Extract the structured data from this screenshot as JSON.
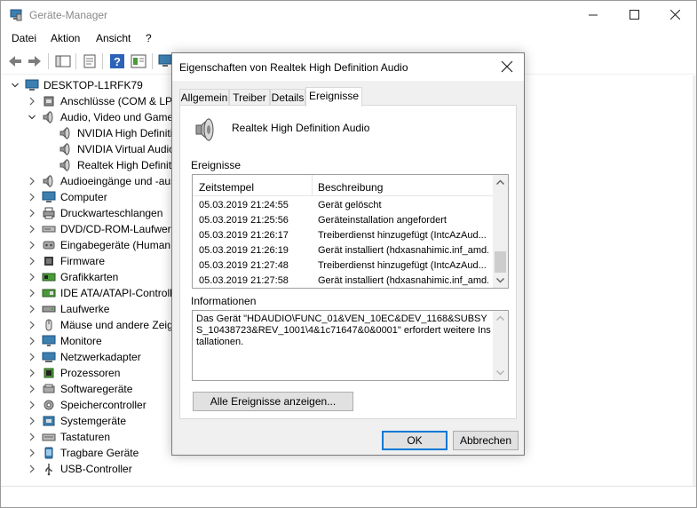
{
  "window": {
    "title": "Geräte-Manager",
    "menu": [
      "Datei",
      "Aktion",
      "Ansicht",
      "?"
    ]
  },
  "toolbar": {
    "icons": [
      "back-arrow-icon",
      "forward-arrow-icon",
      "show-hide-console-tree-icon",
      "properties-icon",
      "help-icon",
      "details-pane-icon",
      "monitor-scan-icon"
    ]
  },
  "tree": {
    "root": "DESKTOP-L1RFK79",
    "items": [
      {
        "label": "Anschlüsse (COM & LPT)",
        "icon": "port-icon",
        "expanded": false,
        "level": 1
      },
      {
        "label": "Audio, Video und Gamecontroller",
        "icon": "speaker-icon",
        "expanded": true,
        "level": 1
      },
      {
        "label": "NVIDIA High Definition Audio",
        "icon": "speaker-icon",
        "level": 2
      },
      {
        "label": "NVIDIA Virtual Audio Device",
        "icon": "speaker-icon",
        "level": 2
      },
      {
        "label": "Realtek High Definition Audio",
        "icon": "speaker-icon",
        "level": 2
      },
      {
        "label": "Audioeingänge und -ausgänge",
        "icon": "speaker-icon",
        "expanded": false,
        "level": 1
      },
      {
        "label": "Computer",
        "icon": "computer-icon",
        "expanded": false,
        "level": 1
      },
      {
        "label": "Druckwarteschlangen",
        "icon": "printer-icon",
        "expanded": false,
        "level": 1
      },
      {
        "label": "DVD/CD-ROM-Laufwerke",
        "icon": "disc-drive-icon",
        "expanded": false,
        "level": 1
      },
      {
        "label": "Eingabegeräte (Human Interface Devices)",
        "icon": "hid-icon",
        "expanded": false,
        "level": 1
      },
      {
        "label": "Firmware",
        "icon": "firmware-icon",
        "expanded": false,
        "level": 1
      },
      {
        "label": "Grafikkarten",
        "icon": "display-adapter-icon",
        "expanded": false,
        "level": 1
      },
      {
        "label": "IDE ATA/ATAPI-Controller",
        "icon": "ide-controller-icon",
        "expanded": false,
        "level": 1
      },
      {
        "label": "Laufwerke",
        "icon": "disk-drive-icon",
        "expanded": false,
        "level": 1
      },
      {
        "label": "Mäuse und andere Zeigegeräte",
        "icon": "mouse-icon",
        "expanded": false,
        "level": 1
      },
      {
        "label": "Monitore",
        "icon": "monitor-icon",
        "expanded": false,
        "level": 1
      },
      {
        "label": "Netzwerkadapter",
        "icon": "network-adapter-icon",
        "expanded": false,
        "level": 1
      },
      {
        "label": "Prozessoren",
        "icon": "processor-icon",
        "expanded": false,
        "level": 1
      },
      {
        "label": "Softwaregeräte",
        "icon": "software-device-icon",
        "expanded": false,
        "level": 1
      },
      {
        "label": "Speichercontroller",
        "icon": "storage-controller-icon",
        "expanded": false,
        "level": 1
      },
      {
        "label": "Systemgeräte",
        "icon": "system-device-icon",
        "expanded": false,
        "level": 1
      },
      {
        "label": "Tastaturen",
        "icon": "keyboard-icon",
        "expanded": false,
        "level": 1
      },
      {
        "label": "Tragbare Geräte",
        "icon": "portable-device-icon",
        "expanded": false,
        "level": 1
      },
      {
        "label": "USB-Controller",
        "icon": "usb-icon",
        "expanded": false,
        "level": 1
      }
    ]
  },
  "dialog": {
    "title": "Eigenschaften von Realtek High Definition Audio",
    "tabs": [
      "Allgemein",
      "Treiber",
      "Details",
      "Ereignisse"
    ],
    "active_tab": "Ereignisse",
    "device_name": "Realtek High Definition Audio",
    "events_label": "Ereignisse",
    "columns": [
      "Zeitstempel",
      "Beschreibung"
    ],
    "events": [
      {
        "time": "05.03.2019 21:24:55",
        "desc": "Gerät gelöscht"
      },
      {
        "time": "05.03.2019 21:25:56",
        "desc": "Geräteinstallation angefordert"
      },
      {
        "time": "05.03.2019 21:26:17",
        "desc": "Treiberdienst hinzugefügt (IntcAzAud..."
      },
      {
        "time": "05.03.2019 21:26:19",
        "desc": "Gerät installiert (hdxasnahimic.inf_amd..."
      },
      {
        "time": "05.03.2019 21:27:48",
        "desc": "Treiberdienst hinzugefügt (IntcAzAud..."
      },
      {
        "time": "05.03.2019 21:27:58",
        "desc": "Gerät installiert (hdxasnahimic.inf_amd..."
      }
    ],
    "info_label": "Informationen",
    "info_text": "Das Gerät \"HDAUDIO\\FUNC_01&VEN_10EC&DEV_1168&SUBSYS_10438723&REV_1001\\4&1c71647&0&0001\" erfordert weitere Installationen.",
    "btn_all": "Alle Ereignisse anzeigen...",
    "btn_ok": "OK",
    "btn_cancel": "Abbrechen"
  }
}
